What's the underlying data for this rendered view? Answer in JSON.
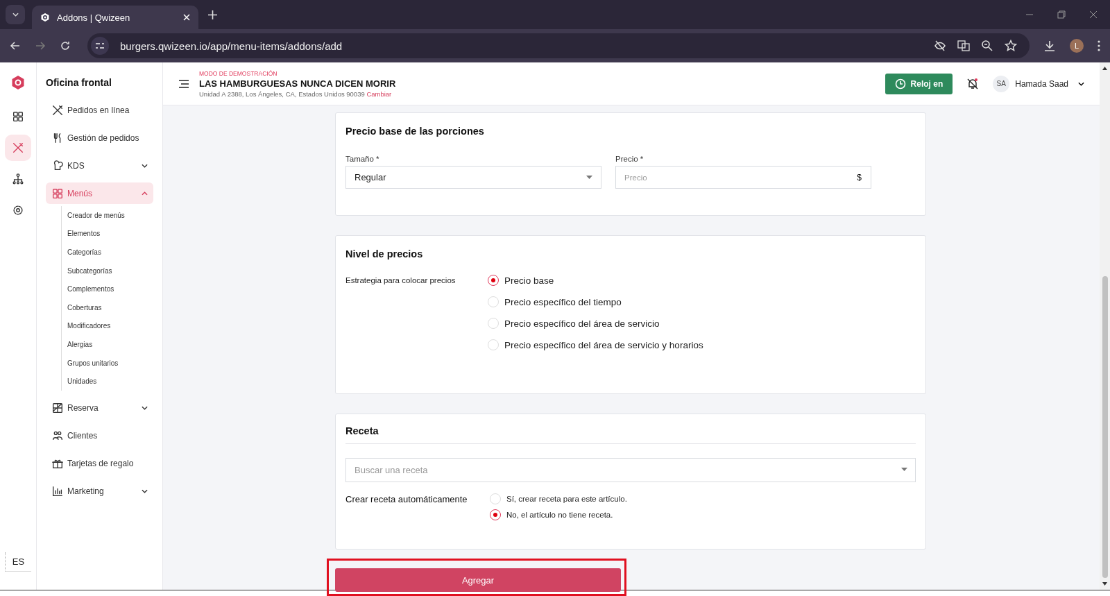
{
  "browser": {
    "tabs": [
      {
        "title": "Addons | Qwizeen",
        "selected": true
      }
    ],
    "url": "burgers.qwizeen.io/app/menu-items/addons/add",
    "profile_initial": "L"
  },
  "rail": [
    {
      "selected": false
    },
    {
      "selected": true
    },
    {
      "selected": false
    },
    {
      "selected": false
    }
  ],
  "language": "ES",
  "sidebar": {
    "title": "Oficina frontal",
    "items": [
      {
        "label": "Pedidos en línea",
        "kind": "link"
      },
      {
        "label": "Gestión de pedidos",
        "kind": "link"
      },
      {
        "label": "KDS",
        "kind": "group",
        "expanded": false
      },
      {
        "label": "Menús",
        "kind": "group",
        "expanded": true,
        "children": [
          {
            "label": "Creador de menús"
          },
          {
            "label": "Elementos"
          },
          {
            "label": "Categorías"
          },
          {
            "label": "Subcategorías"
          },
          {
            "label": "Complementos"
          },
          {
            "label": "Coberturas"
          },
          {
            "label": "Modificadores"
          },
          {
            "label": "Alergias"
          },
          {
            "label": "Grupos unitarios"
          },
          {
            "label": "Unidades"
          }
        ]
      },
      {
        "label": "Reserva",
        "kind": "group",
        "expanded": false
      },
      {
        "label": "Clientes",
        "kind": "link"
      },
      {
        "label": "Tarjetas de regalo",
        "kind": "link"
      },
      {
        "label": "Marketing",
        "kind": "group",
        "expanded": false
      }
    ]
  },
  "header": {
    "demo_label": "MODO DE DEMOSTRACIÓN",
    "store_name": "LAS HAMBURGUESAS NUNCA DICEN MORIR",
    "address": "Unidad A 2388, Los Ángeles, CA, Estados Unidos 90039",
    "change_link": "Cambiar",
    "clock_button": "Reloj en",
    "user_initials": "SA",
    "user_name": "Hamada Saad"
  },
  "portion_card": {
    "title": "Precio base de las porciones",
    "size_label": "Tamaño *",
    "size_value": "Regular",
    "price_label": "Precio *",
    "price_placeholder": "Precio",
    "currency": "$"
  },
  "pricing_card": {
    "title": "Nivel de precios",
    "strategy_label": "Estrategia para colocar precios",
    "options": [
      {
        "label": "Precio base",
        "selected": true
      },
      {
        "label": "Precio específico del tiempo",
        "selected": false
      },
      {
        "label": "Precio específico del área de servicio",
        "selected": false
      },
      {
        "label": "Precio específico del área de servicio y horarios",
        "selected": false
      }
    ]
  },
  "recipe_card": {
    "title": "Receta",
    "search_placeholder": "Buscar una receta",
    "auto_label": "Crear receta automáticamente",
    "options": [
      {
        "label": "Sí, crear receta para este artículo.",
        "selected": false
      },
      {
        "label": "No, el artículo no tiene receta.",
        "selected": true
      }
    ]
  },
  "submit_button": "Agregar"
}
